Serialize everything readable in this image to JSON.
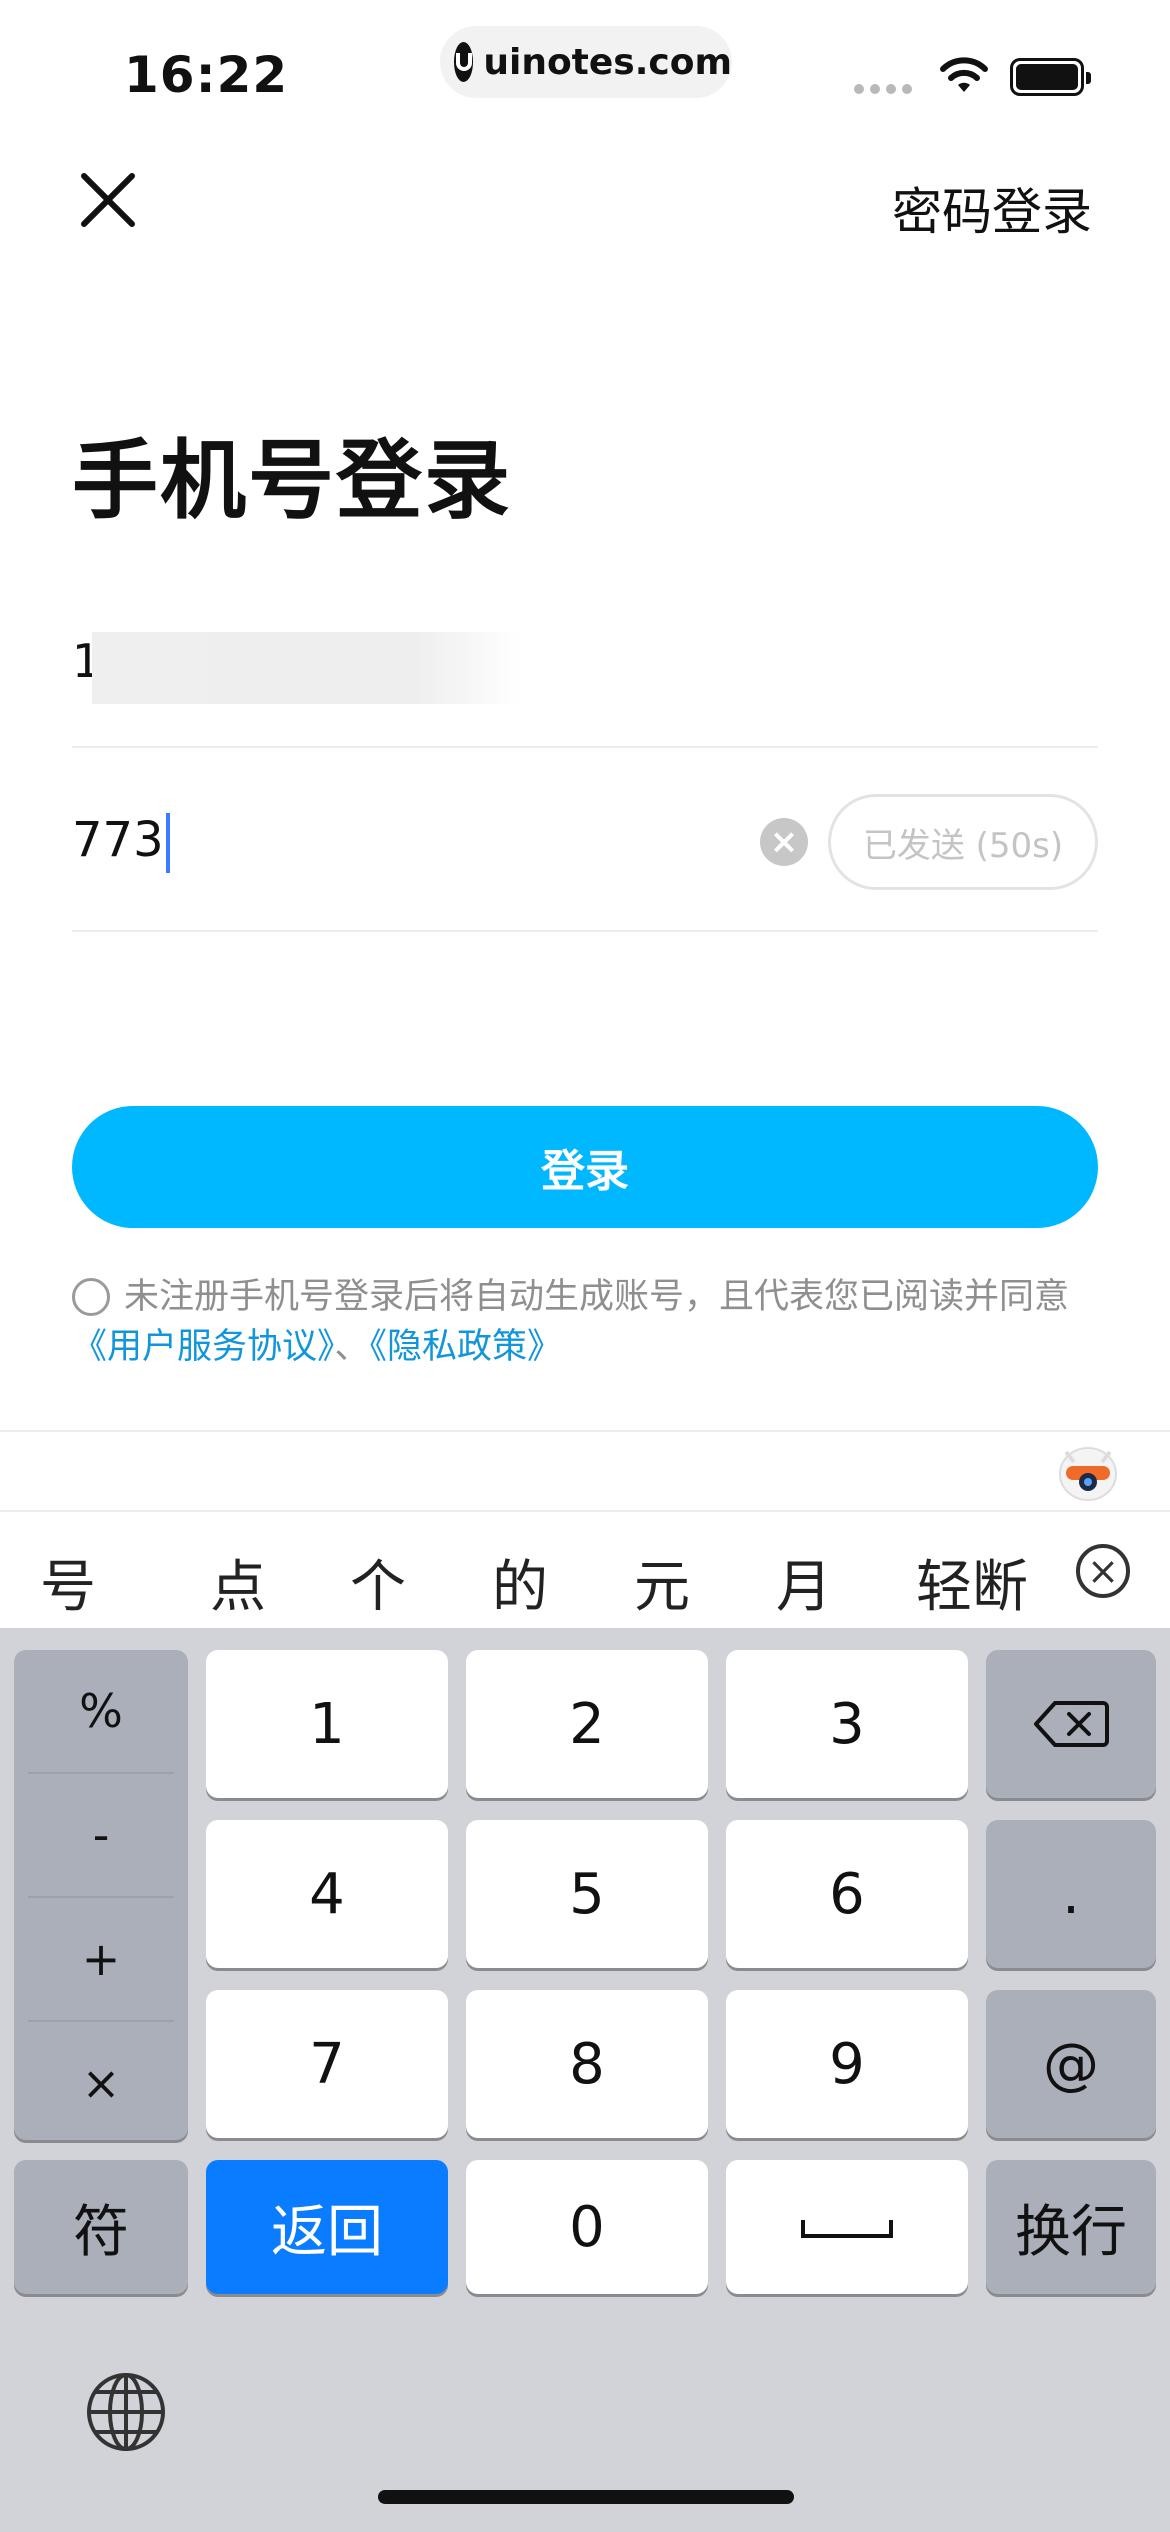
{
  "status_bar": {
    "time": "16:22",
    "url": "uinotes.com"
  },
  "header": {
    "password_login": "密码登录"
  },
  "title": "手机号登录",
  "phone_field": {
    "value": "1"
  },
  "code_field": {
    "value": "773",
    "sent_label": "已发送 (50s)"
  },
  "login_button": "登录",
  "agreement": {
    "text": "未注册手机号登录后将自动生成账号，且代表您已阅读并同意",
    "user_agreement": "《用户服务协议》",
    "separator": "、",
    "privacy_policy": "《隐私政策》"
  },
  "candidates": [
    "号",
    "点",
    "个",
    "的",
    "元",
    "月",
    "轻断"
  ],
  "keyboard": {
    "symbols": [
      "%",
      "-",
      "+",
      "×"
    ],
    "digits": [
      "1",
      "2",
      "3",
      "4",
      "5",
      "6",
      "7",
      "8",
      "9",
      "0"
    ],
    "dot": ".",
    "at": "@",
    "fu": "符",
    "back": "返回",
    "newline": "换行"
  },
  "colors": {
    "accent": "#00b8ff",
    "link": "#1296db",
    "keyboard_bg": "#d1d3d9",
    "return_key": "#0a7cff"
  }
}
